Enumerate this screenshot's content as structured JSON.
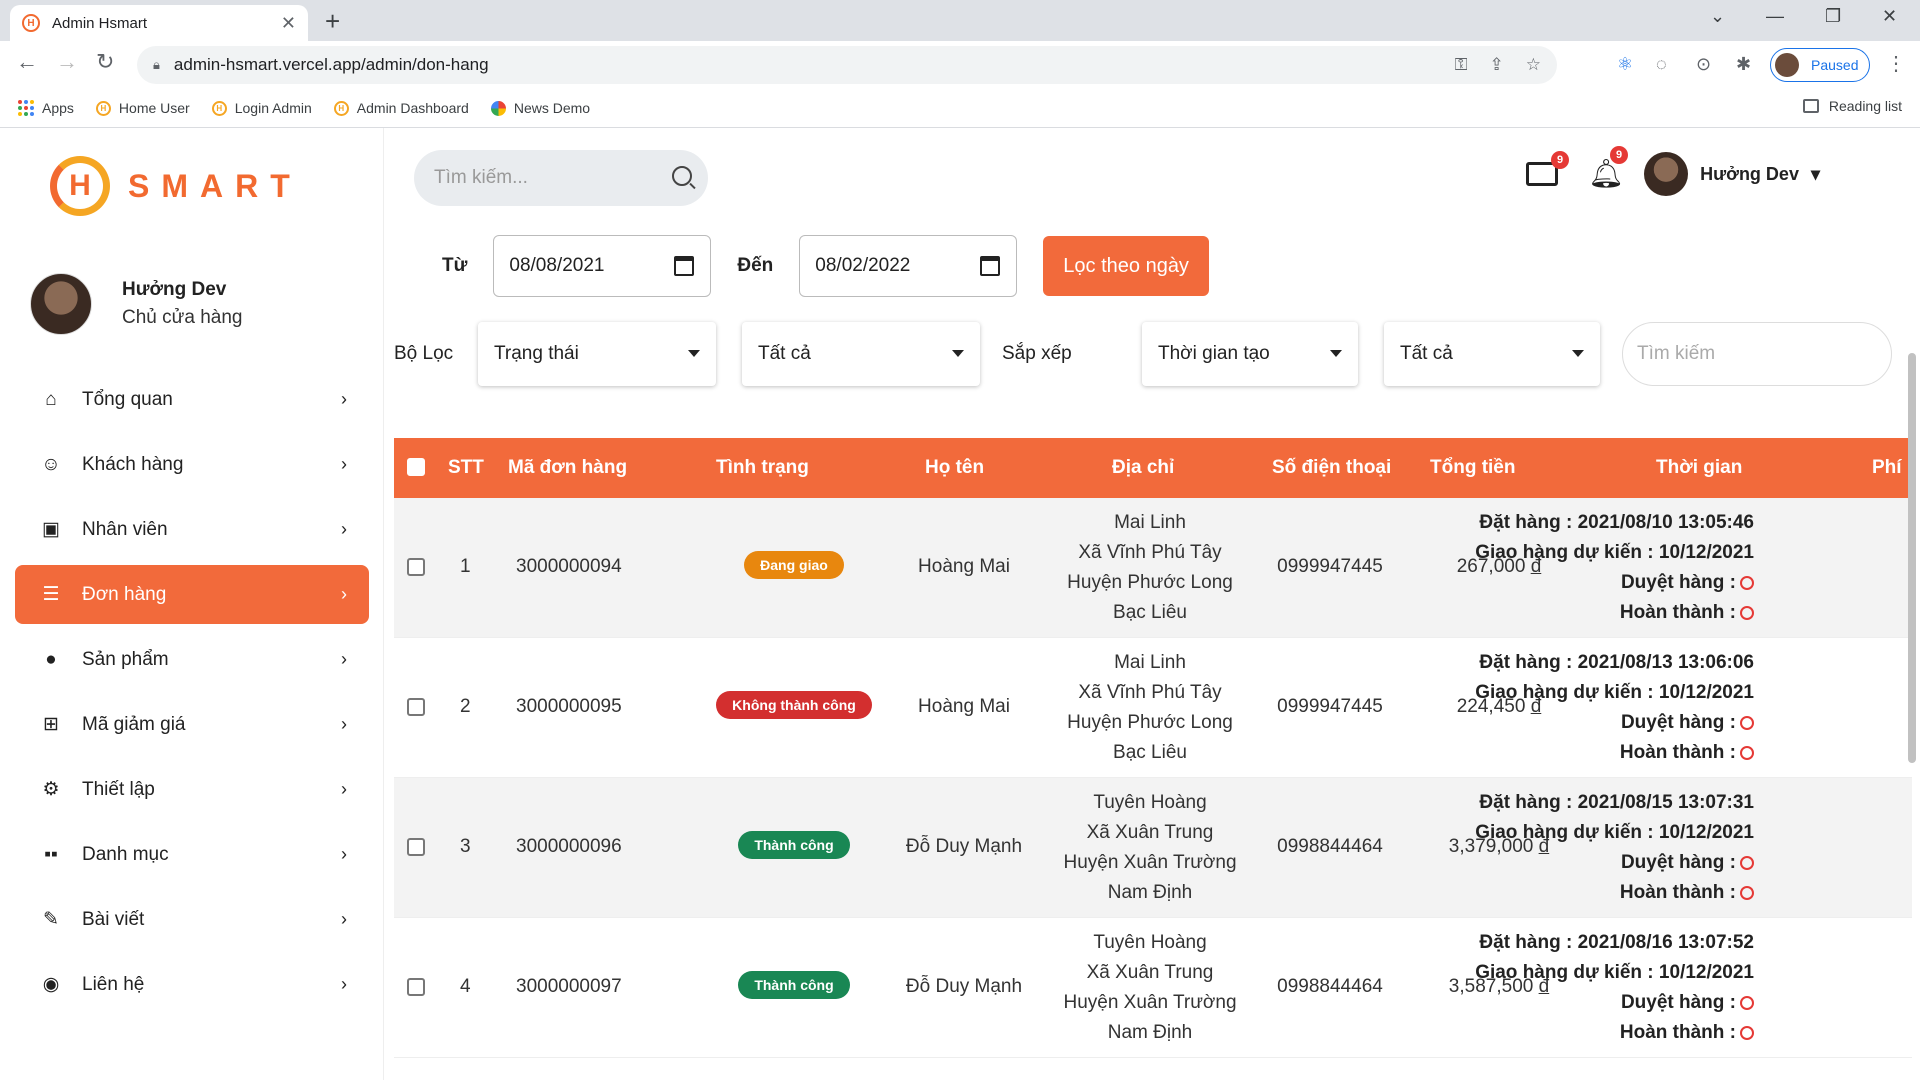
{
  "browser": {
    "tab_title": "Admin Hsmart",
    "url": "admin-hsmart.vercel.app/admin/don-hang",
    "profile_status": "Paused",
    "bookmarks": [
      "Apps",
      "Home User",
      "Login Admin",
      "Admin Dashboard",
      "News Demo"
    ],
    "reading_list": "Reading list"
  },
  "sidebar": {
    "logo_letter": "H",
    "logo_text": "SMART",
    "user_name": "Hưởng Dev",
    "user_role": "Chủ cửa hàng",
    "items": [
      {
        "label": "Tổng quan",
        "icon": "home-icon",
        "active": false
      },
      {
        "label": "Khách hàng",
        "icon": "user-icon",
        "active": false
      },
      {
        "label": "Nhân viên",
        "icon": "badge-icon",
        "active": false
      },
      {
        "label": "Đơn hàng",
        "icon": "order-icon",
        "active": true
      },
      {
        "label": "Sản phẩm",
        "icon": "product-icon",
        "active": false
      },
      {
        "label": "Mã giảm giá",
        "icon": "gift-icon",
        "active": false
      },
      {
        "label": "Thiết lập",
        "icon": "gear-icon",
        "active": false
      },
      {
        "label": "Danh mục",
        "icon": "category-icon",
        "active": false
      },
      {
        "label": "Bài viết",
        "icon": "pen-icon",
        "active": false
      },
      {
        "label": "Liên hệ",
        "icon": "contact-icon",
        "active": false
      }
    ]
  },
  "header": {
    "search_placeholder": "Tìm kiếm...",
    "mail_count": "9",
    "notif_count": "9",
    "user_name": "Hưởng Dev"
  },
  "filters": {
    "from_label": "Từ",
    "from_date": "08/08/2021",
    "to_label": "Đến",
    "to_date": "08/02/2022",
    "filter_button": "Lọc theo ngày",
    "filter_label": "Bộ Lọc",
    "status_select": "Trạng thái",
    "status_value_select": "Tất cả",
    "sort_label": "Sắp xếp",
    "sort_select": "Thời gian tạo",
    "sort_order_select": "Tất cả",
    "search_placeholder": "Tìm kiếm"
  },
  "table": {
    "headers": [
      "STT",
      "Mã đơn hàng",
      "Tình trạng",
      "Họ tên",
      "Địa chỉ",
      "Số điện thoại",
      "Tổng tiền",
      "Thời gian",
      "Phí"
    ],
    "rows": [
      {
        "stt": "1",
        "code": "3000000094",
        "status": "Đang giao",
        "status_color": "#e8870e",
        "name": "Hoàng Mai",
        "addr": [
          "Mai Linh",
          "Xã Vĩnh Phú Tây",
          "Huyện Phước Long",
          "Bạc Liêu"
        ],
        "phone": "0999947445",
        "total": "267,000",
        "currency": "đ",
        "t_order": "Đặt hàng : 2021/08/10 13:05:46",
        "t_expected": "Giao hàng dự kiến : 10/12/2021",
        "t_approve": "Duyệt hàng :",
        "t_done": "Hoàn thành :"
      },
      {
        "stt": "2",
        "code": "3000000095",
        "status": "Không thành công",
        "status_color": "#d32f2f",
        "name": "Hoàng Mai",
        "addr": [
          "Mai Linh",
          "Xã Vĩnh Phú Tây",
          "Huyện Phước Long",
          "Bạc Liêu"
        ],
        "phone": "0999947445",
        "total": "224,450",
        "currency": "đ",
        "t_order": "Đặt hàng : 2021/08/13 13:06:06",
        "t_expected": "Giao hàng dự kiến : 10/12/2021",
        "t_approve": "Duyệt hàng :",
        "t_done": "Hoàn thành :"
      },
      {
        "stt": "3",
        "code": "3000000096",
        "status": "Thành công",
        "status_color": "#198754",
        "name": "Đỗ Duy Mạnh",
        "addr": [
          "Tuyên Hoàng",
          "Xã Xuân Trung",
          "Huyện Xuân Trường",
          "Nam Định"
        ],
        "phone": "0998844464",
        "total": "3,379,000",
        "currency": "đ",
        "t_order": "Đặt hàng : 2021/08/15 13:07:31",
        "t_expected": "Giao hàng dự kiến : 10/12/2021",
        "t_approve": "Duyệt hàng :",
        "t_done": "Hoàn thành :"
      },
      {
        "stt": "4",
        "code": "3000000097",
        "status": "Thành công",
        "status_color": "#198754",
        "name": "Đỗ Duy Mạnh",
        "addr": [
          "Tuyên Hoàng",
          "Xã Xuân Trung",
          "Huyện Xuân Trường",
          "Nam Định"
        ],
        "phone": "0998844464",
        "total": "3,587,500",
        "currency": "đ",
        "t_order": "Đặt hàng : 2021/08/16 13:07:52",
        "t_expected": "Giao hàng dự kiến : 10/12/2021",
        "t_approve": "Duyệt hàng :",
        "t_done": "Hoàn thành :"
      }
    ]
  },
  "colors": {
    "accent": "#f26a3b",
    "brand_yellow": "#f5a623"
  }
}
